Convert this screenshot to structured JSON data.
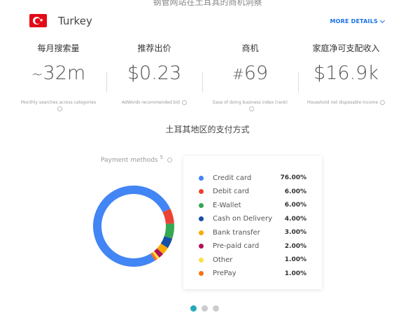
{
  "top_caption": "钢管网站在土耳其的商机洞察",
  "country": {
    "name": "Turkey"
  },
  "more_details": "MORE DETAILS",
  "stats": [
    {
      "title": "每月搜索量",
      "prefix": "~",
      "value": "32m",
      "subtitle": "Monthly searches across categories"
    },
    {
      "title": "推荐出价",
      "prefix": "",
      "value": "$0.23",
      "subtitle": "AdWords recommended bid"
    },
    {
      "title": "商机",
      "prefix": "#",
      "value": "69",
      "subtitle": "Ease of doing business index (rank)"
    },
    {
      "title": "家庭净可支配收入",
      "prefix": "",
      "value": "$16.9k",
      "subtitle": "Household net disposable income"
    }
  ],
  "section_title": "土耳其地区的支付方式",
  "payment": {
    "label": "Payment methods",
    "count": "5",
    "methods": [
      {
        "name": "Credit card",
        "percent": "76.00%",
        "share": 76,
        "color": "#4285f4"
      },
      {
        "name": "Debit card",
        "percent": "6.00%",
        "share": 6,
        "color": "#ea4335"
      },
      {
        "name": "E-Wallet",
        "percent": "6.00%",
        "share": 6,
        "color": "#34a853"
      },
      {
        "name": "Cash on Delivery",
        "percent": "4.00%",
        "share": 4,
        "color": "#174ea6"
      },
      {
        "name": "Bank transfer",
        "percent": "3.00%",
        "share": 3,
        "color": "#f9ab00"
      },
      {
        "name": "Pre-paid card",
        "percent": "2.00%",
        "share": 2,
        "color": "#b31256"
      },
      {
        "name": "Other",
        "percent": "1.00%",
        "share": 1,
        "color": "#fde047"
      },
      {
        "name": "PrePay",
        "percent": "1.00%",
        "share": 1,
        "color": "#f97316"
      }
    ]
  },
  "pager": {
    "pages": 3,
    "active_index": 0
  }
}
